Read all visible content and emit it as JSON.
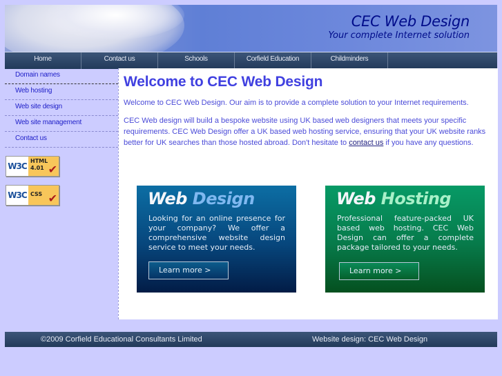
{
  "header": {
    "title": "CEC Web Design",
    "tagline": "Your complete Internet solution"
  },
  "nav": {
    "items": [
      {
        "label": "Home"
      },
      {
        "label": "Contact us"
      },
      {
        "label": "Schools"
      },
      {
        "label": "Corfield Education"
      },
      {
        "label": "Childminders"
      }
    ]
  },
  "sidebar": {
    "items": [
      {
        "label": "Domain names"
      },
      {
        "label": "Web hosting"
      },
      {
        "label": "Web site design"
      },
      {
        "label": "Web site management"
      },
      {
        "label": "Contact us"
      }
    ],
    "badges": [
      {
        "logo": "W3C",
        "line1": "HTML",
        "line2": "4.01",
        "icon": "check-icon"
      },
      {
        "logo": "W3C",
        "line1": "CSS",
        "line2": "",
        "icon": "check-icon"
      }
    ]
  },
  "main": {
    "heading": "Welcome to CEC Web Design",
    "para1": "Welcome to CEC Web Design. Our aim is to provide a complete solution to your Internet requirements.",
    "para2_before": "CEC Web design will build a bespoke website using UK based web designers that meets your specific requirements. CEC Web Design offer a UK based web hosting service, ensuring that your UK website ranks better for UK searches than those hosted abroad. Don't hesitate to ",
    "para2_link": "contact us",
    "para2_after": " if you have any questions.",
    "promos": [
      {
        "title_a": "Web",
        "title_b": "Design",
        "text": "Looking for an online presence for your company? We offer a comprehensive website design service to meet your needs.",
        "button": "Learn more >",
        "color": "#07467c"
      },
      {
        "title_a": "Web",
        "title_b": "Hosting",
        "text": "Professional feature-packed UK based web hosting. CEC Web Design can offer a complete package tailored to your needs.",
        "button": "Learn more >",
        "color": "#077a4a"
      }
    ]
  },
  "footer": {
    "copyright": "©2009 Corfield Educational Consultants Limited",
    "credit": "Website design: CEC Web Design"
  },
  "colors": {
    "background": "#ccccff",
    "heading": "#4040e0",
    "nav": "#2c4468"
  }
}
